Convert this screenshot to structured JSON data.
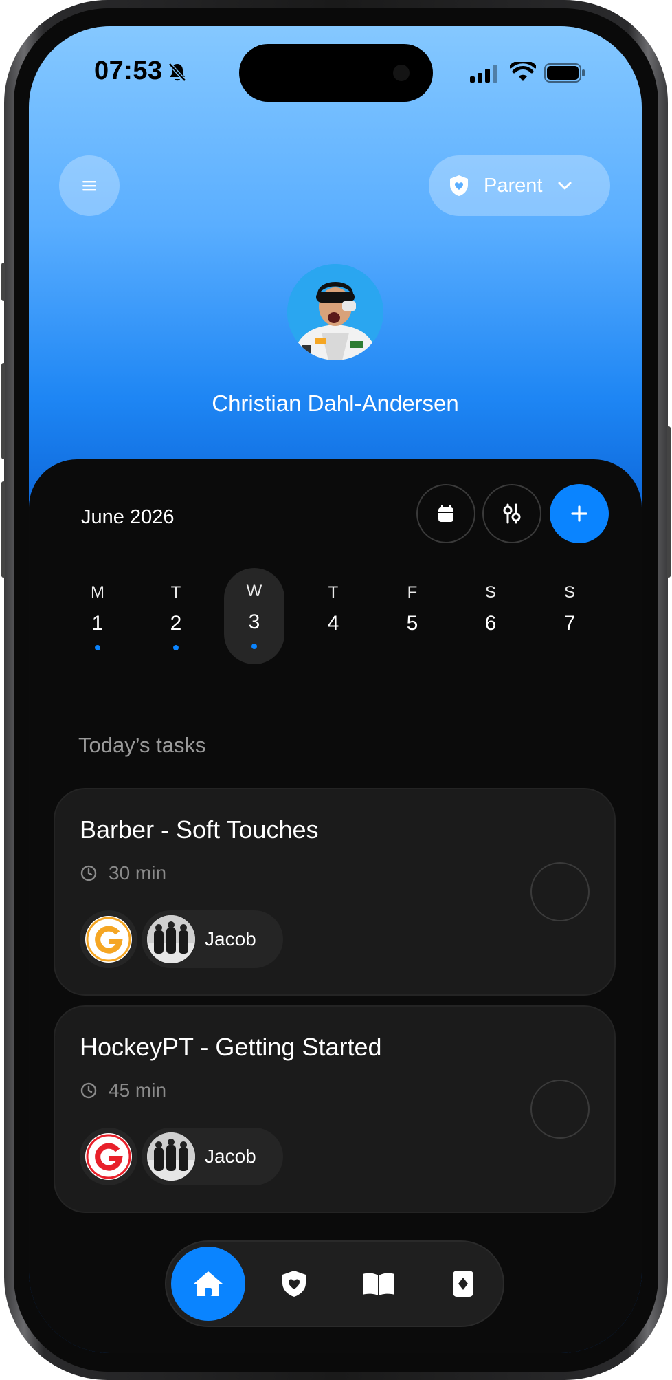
{
  "status_bar": {
    "time": "07:53",
    "icons": [
      "bell-off-icon",
      "signal-icon",
      "wifi-icon",
      "battery-icon"
    ]
  },
  "header": {
    "menu_icon": "menu-icon",
    "role_label": "Parent",
    "role_icon": "shield-heart-icon"
  },
  "profile": {
    "name": "Christian Dahl-Andersen"
  },
  "calendar": {
    "month_label": "June 2026",
    "actions": [
      "calendar-icon",
      "filter-icon",
      "plus-icon"
    ],
    "days": [
      {
        "letter": "M",
        "number": "1",
        "has_dot": true,
        "selected": false
      },
      {
        "letter": "T",
        "number": "2",
        "has_dot": true,
        "selected": false
      },
      {
        "letter": "W",
        "number": "3",
        "has_dot": true,
        "selected": true
      },
      {
        "letter": "T",
        "number": "4",
        "has_dot": false,
        "selected": false
      },
      {
        "letter": "F",
        "number": "5",
        "has_dot": false,
        "selected": false
      },
      {
        "letter": "S",
        "number": "6",
        "has_dot": false,
        "selected": false
      },
      {
        "letter": "S",
        "number": "7",
        "has_dot": false,
        "selected": false
      }
    ]
  },
  "tasks_section": {
    "title": "Today’s tasks",
    "tasks": [
      {
        "title": "Barber - Soft Touches",
        "duration": "30 min",
        "assignee": "Jacob",
        "logo_color": "#f5a623"
      },
      {
        "title": "HockeyPT - Getting Started",
        "duration": "45 min",
        "assignee": "Jacob",
        "logo_color": "#e8202a"
      }
    ]
  },
  "tab_bar": {
    "tabs": [
      "home-icon",
      "shield-heart-icon",
      "book-icon",
      "card-icon"
    ],
    "active": 0
  },
  "colors": {
    "accent": "#0a84ff",
    "panel": "#0b0b0b",
    "card": "#1b1b1b"
  }
}
